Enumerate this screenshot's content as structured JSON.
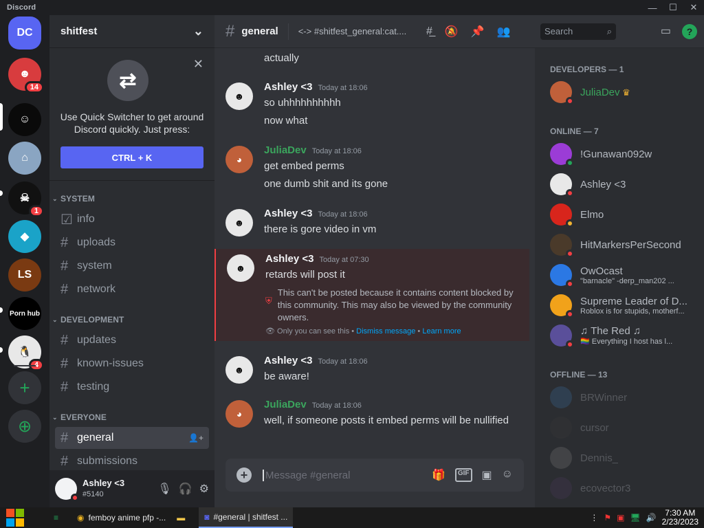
{
  "window": {
    "title": "Discord",
    "controls": {
      "minimize": "—",
      "maximize": "☐",
      "close": "✕"
    }
  },
  "guilds": [
    {
      "initials": "DC",
      "color": "#5865f2",
      "badge": ""
    },
    {
      "initials": "☻",
      "color": "#d83c3e",
      "badge": "14"
    },
    {
      "initials": "☺",
      "color": "#0a0a0a",
      "badge": ""
    },
    {
      "initials": "⌂",
      "color": "#8aa5c2",
      "badge": ""
    },
    {
      "initials": "☠",
      "color": "#111111",
      "badge": "1"
    },
    {
      "initials": "◆",
      "color": "#1aa3c8",
      "badge": ""
    },
    {
      "initials": "LS",
      "color": "#7a3a12",
      "badge": ""
    },
    {
      "initials": "Porn hub",
      "color": "#000000",
      "badge": ""
    },
    {
      "initials": "🐧",
      "color": "#e8e8e8",
      "badge": "4"
    }
  ],
  "guild_actions": {
    "add": "+",
    "explore": "⊕"
  },
  "server": {
    "name": "shitfest",
    "dropdown": "⌄"
  },
  "quick_switcher": {
    "text": "Use Quick Switcher to get around Discord quickly. Just press:",
    "button": "CTRL + K",
    "close": "✕"
  },
  "categories": [
    {
      "name": "SYSTEM",
      "channels": [
        {
          "name": "info",
          "type": "rules"
        },
        {
          "name": "uploads"
        },
        {
          "name": "system"
        },
        {
          "name": "network"
        }
      ]
    },
    {
      "name": "DEVELOPMENT",
      "channels": [
        {
          "name": "updates"
        },
        {
          "name": "known-issues"
        },
        {
          "name": "testing"
        }
      ]
    },
    {
      "name": "EVERYONE",
      "channels": [
        {
          "name": "general",
          "active": true
        },
        {
          "name": "submissions"
        }
      ]
    }
  ],
  "user": {
    "name": "Ashley <3",
    "tag": "#5140"
  },
  "channel": {
    "name": "general",
    "topic": "<-> #shitfest_general:cat...."
  },
  "search": {
    "placeholder": "Search"
  },
  "messages": [
    {
      "author": "",
      "time": "",
      "lines": [
        "actually"
      ],
      "continuation": true
    },
    {
      "author": "Ashley <3",
      "time": "Today at 18:06",
      "lines": [
        "so uhhhhhhhhhh",
        "now what"
      ]
    },
    {
      "author": "JuliaDev",
      "time": "Today at 18:06",
      "lines": [
        "get embed perms",
        "one dumb shit and its gone"
      ],
      "green": true
    },
    {
      "author": "Ashley <3",
      "time": "Today at 18:06",
      "lines": [
        "there is gore video in vm"
      ]
    },
    {
      "author": "Ashley <3",
      "time": "Today at 07:30",
      "lines": [
        "retards will post it"
      ],
      "blocked": true
    },
    {
      "author": "Ashley <3",
      "time": "Today at 18:06",
      "lines": [
        "be aware!"
      ]
    },
    {
      "author": "JuliaDev",
      "time": "Today at 18:06",
      "lines": [
        "well, if someone posts it embed perms will be nullified"
      ],
      "green": true
    }
  ],
  "blocked_notice": {
    "text": "This can't be posted because it contains content blocked by this community. This may also be viewed by the community owners.",
    "only_you": "Only you can see this •",
    "dismiss": "Dismiss message",
    "bullet": "•",
    "learn": "Learn more"
  },
  "composer": {
    "placeholder": "Message #general",
    "gif": "GIF"
  },
  "member_groups": [
    {
      "title": "DEVELOPERS — 1",
      "members": [
        {
          "name": "JuliaDev",
          "status": "",
          "color": "#c0603a",
          "state": "dnd",
          "green": true,
          "crown": true
        }
      ]
    },
    {
      "title": "ONLINE — 7",
      "members": [
        {
          "name": "!Gunawan092w",
          "status": "",
          "color": "#9b3cd6",
          "state": "online"
        },
        {
          "name": "Ashley <3",
          "status": "",
          "color": "#e8e8e8",
          "state": "dnd"
        },
        {
          "name": "Elmo",
          "status": "",
          "color": "#d8251c",
          "state": "idle"
        },
        {
          "name": "HitMarkersPerSecond",
          "status": "",
          "color": "#4a3a2a",
          "state": "dnd"
        },
        {
          "name": "OwOcast",
          "status": "\"barnacle\" -derp_man202 ...",
          "color": "#2b78e4",
          "state": "dnd"
        },
        {
          "name": "Supreme Leader of D...",
          "status": "Roblox is for stupids, motherf...",
          "color": "#f1a21a",
          "state": "dnd"
        },
        {
          "name": "♫ The Red ♫",
          "status": "🏳️‍🌈 Everything I host has l...",
          "color": "#5a4f9a",
          "state": "dnd"
        }
      ]
    },
    {
      "title": "OFFLINE — 13",
      "members": [
        {
          "name": "BRWinner",
          "status": "",
          "color": "#3a6a9a"
        },
        {
          "name": "cursor",
          "status": "",
          "color": "#3a3a3a"
        },
        {
          "name": "Dennis_",
          "status": "",
          "color": "#777777"
        },
        {
          "name": "ecovector3",
          "status": "",
          "color": "#4a3a5a"
        }
      ]
    }
  ],
  "taskbar": {
    "apps": [
      {
        "label": "",
        "icon": "≡",
        "color": "#23a559"
      },
      {
        "label": "femboy anime pfp -...",
        "icon": "◉",
        "color": "#e8b020"
      },
      {
        "label": "",
        "icon": "▬",
        "color": "#f0c64a"
      },
      {
        "label": "#general | shitfest ...",
        "icon": "◙",
        "color": "#5865f2",
        "active": true
      }
    ],
    "time": "7:30 AM",
    "date": "2/23/2023"
  }
}
